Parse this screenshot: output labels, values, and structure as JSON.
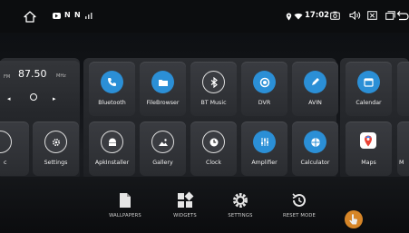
{
  "status_bar": {
    "time": "17:02",
    "notification_badges": [
      "N",
      "N"
    ]
  },
  "radio_widget": {
    "frequency": "87.50",
    "unit": "MHz"
  },
  "apps_row1": [
    {
      "label": "Bluetooth",
      "icon": "phone-icon",
      "color": "#2b8fd6"
    },
    {
      "label": "FileBrowser",
      "icon": "folder-icon",
      "color": "#2b8fd6"
    },
    {
      "label": "BT Music",
      "icon": "bluetooth-icon",
      "color": "#2b8fd6"
    },
    {
      "label": "DVR",
      "icon": "record-icon",
      "color": "#2b8fd6"
    },
    {
      "label": "AVIN",
      "icon": "pen-icon",
      "color": "#2b8fd6"
    },
    {
      "label": "Calendar",
      "icon": "calendar-icon",
      "color": "#2b8fd6"
    }
  ],
  "apps_row2": [
    {
      "label": "Settings",
      "icon": "gear-icon",
      "color": "#2b8fd6"
    },
    {
      "label": "ApkInstaller",
      "icon": "android-icon",
      "color": "#2b8fd6"
    },
    {
      "label": "Gallery",
      "icon": "gallery-icon",
      "color": "#2b8fd6"
    },
    {
      "label": "Clock",
      "icon": "clock-icon",
      "color": "#2b8fd6"
    },
    {
      "label": "Amplifier",
      "icon": "equalizer-icon",
      "color": "#2b8fd6"
    },
    {
      "label": "Calculator",
      "icon": "calculator-icon",
      "color": "#2b8fd6"
    },
    {
      "label": "Maps",
      "icon": "maps-icon",
      "color": "#ffffff"
    }
  ],
  "partial_labels": {
    "left_row2": "c",
    "right_row2": "M"
  },
  "dock": [
    {
      "label": "WALLPAPERS",
      "icon": "wallpaper-icon"
    },
    {
      "label": "WIDGETS",
      "icon": "widgets-icon"
    },
    {
      "label": "SETTINGS",
      "icon": "gear-icon"
    },
    {
      "label": "RESET MODE",
      "icon": "reset-icon"
    }
  ],
  "colors": {
    "accent": "#2b8fd6",
    "cursor": "#e8902a"
  }
}
